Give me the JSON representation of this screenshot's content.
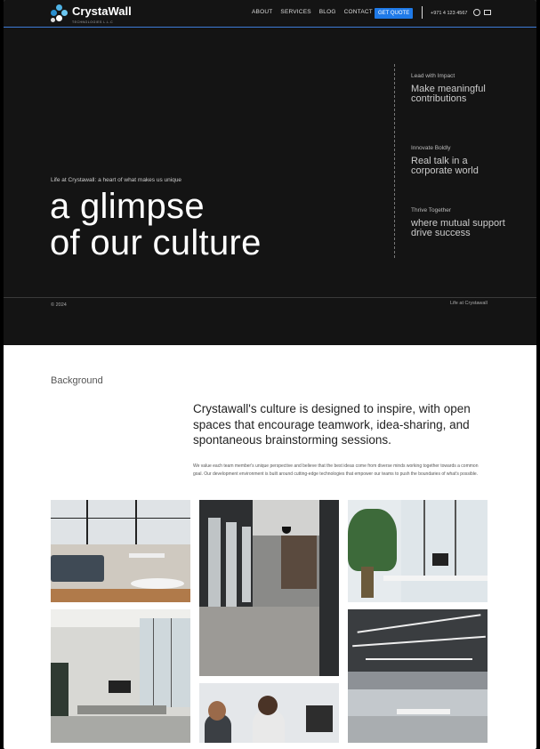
{
  "header": {
    "logo_text": "CrystaWall",
    "logo_sub": "TECHNOLOGIES L.L.C",
    "nav": [
      "ABOUT",
      "SERVICES",
      "BLOG",
      "CONTACT"
    ],
    "cta": "GET QUOTE",
    "phone": "+971 4 123 4567"
  },
  "hero": {
    "eyebrow": "Life at Crystawall: a heart of what makes us unique",
    "title_line1": "a glimpse",
    "title_line2": "of our culture",
    "values": [
      {
        "key": "Lead with Impact",
        "text": "Make meaningful contributions"
      },
      {
        "key": "Innovate Boldly",
        "text": "Real talk in a corporate world"
      },
      {
        "key": "Thrive Together",
        "text": "where mutual support drive success"
      }
    ],
    "copyright": "© 2024",
    "footer_right": "Life at Crystawall"
  },
  "background": {
    "label": "Background",
    "lead": "Crystawall's culture is designed to inspire, with open spaces that encourage teamwork, idea-sharing, and spontaneous brainstorming sessions.",
    "body": "We value each team member's unique perspective and believe that the best ideas come from diverse minds working together towards a common goal. Our development environment is built around cutting-edge technologies that empower our teams to push the boundaries of what's possible."
  },
  "colors": {
    "accent": "#1f7ae8",
    "dark_bg": "#141414",
    "line": "#3d7ad6"
  },
  "icons": [
    "whatsapp-icon",
    "mail-icon",
    "logo-icon"
  ]
}
